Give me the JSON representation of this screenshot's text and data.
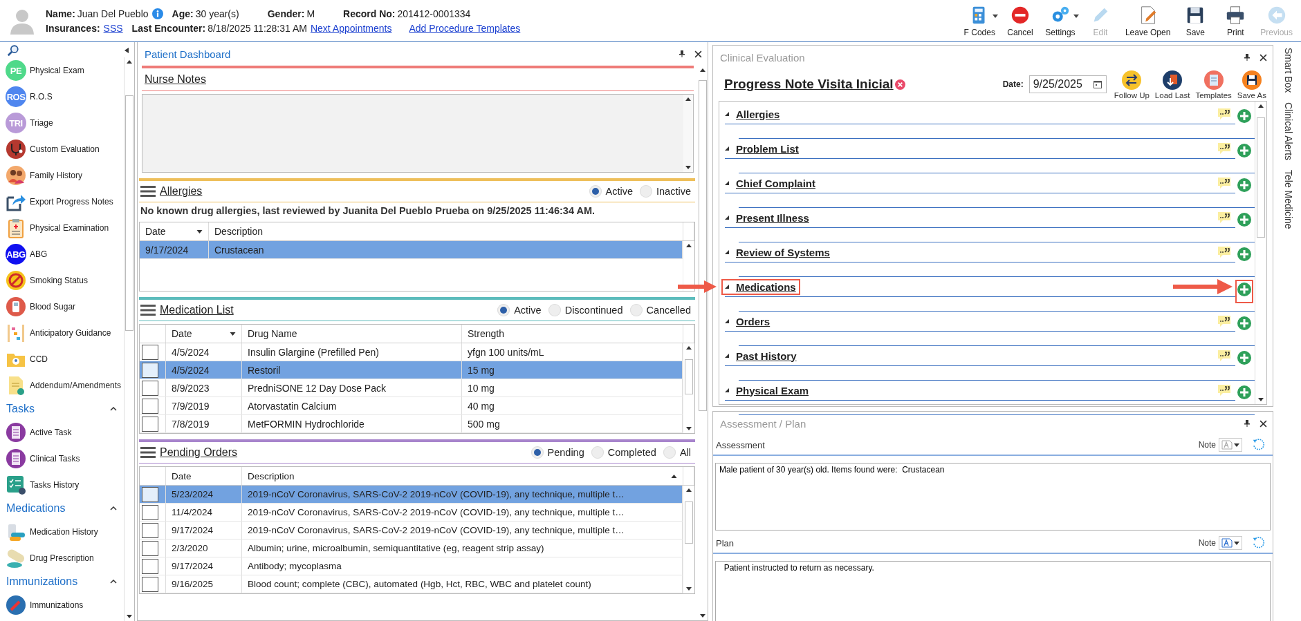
{
  "header": {
    "name_label": "Name:",
    "name": "Juan Del Pueblo",
    "age_label": "Age:",
    "age": "30 year(s)",
    "gender_label": "Gender:",
    "gender": "M",
    "record_label": "Record No:",
    "record": "201412-0001334",
    "insurances_label": "Insurances:",
    "insurance": "SSS",
    "last_encounter_label": "Last Encounter:",
    "last_encounter": "8/18/2025 11:28:31 AM",
    "links": [
      "Next Appointments",
      "Add Procedure Templates"
    ]
  },
  "toolbar": [
    {
      "label": "F Codes",
      "kind": "calculator",
      "dropdown": true,
      "disabled": false
    },
    {
      "label": "Cancel",
      "kind": "cancel",
      "dropdown": false,
      "disabled": false
    },
    {
      "label": "Settings",
      "kind": "gears",
      "dropdown": true,
      "disabled": false
    },
    {
      "label": "Edit",
      "kind": "pencil",
      "dropdown": false,
      "disabled": true
    },
    {
      "label": "Leave Open",
      "kind": "document",
      "dropdown": false,
      "disabled": false
    },
    {
      "label": "Save",
      "kind": "floppy",
      "dropdown": false,
      "disabled": false
    },
    {
      "label": "Print",
      "kind": "printer",
      "dropdown": false,
      "disabled": false
    },
    {
      "label": "Previous",
      "kind": "back",
      "dropdown": false,
      "disabled": true
    }
  ],
  "sidebar": {
    "groups": [
      {
        "items": [
          {
            "label": "Physical Exam",
            "kind": "badge",
            "badge": "PE",
            "color": "#4fd98a"
          },
          {
            "label": "R.O.S",
            "kind": "badge",
            "badge": "ROS",
            "color": "#4f86ef"
          },
          {
            "label": "Triage",
            "kind": "badge",
            "badge": "TRI",
            "color": "#b99ad8"
          },
          {
            "label": "Custom Evaluation",
            "kind": "stethoscope"
          },
          {
            "label": "Family History",
            "kind": "family"
          },
          {
            "label": "Export Progress Notes",
            "kind": "export"
          },
          {
            "label": "Physical Examination",
            "kind": "clipboard"
          },
          {
            "label": "ABG",
            "kind": "badge",
            "badge": "ABG",
            "color": "#1010f0"
          },
          {
            "label": "Smoking Status",
            "kind": "smoking"
          },
          {
            "label": "Blood Sugar",
            "kind": "glucometer"
          },
          {
            "label": "Anticipatory Guidance",
            "kind": "abacus"
          },
          {
            "label": "CCD",
            "kind": "folder"
          },
          {
            "label": "Addendum/Amendments",
            "kind": "note"
          }
        ]
      },
      {
        "title": "Tasks",
        "expanded": true,
        "items": [
          {
            "label": "Active Task",
            "kind": "task"
          },
          {
            "label": "Clinical Tasks",
            "kind": "task"
          },
          {
            "label": "Tasks History",
            "kind": "checklist"
          }
        ]
      },
      {
        "title": "Medications",
        "expanded": true,
        "items": [
          {
            "label": "Medication History",
            "kind": "pills"
          },
          {
            "label": "Drug Prescription",
            "kind": "capsule"
          }
        ]
      },
      {
        "title": "Immunizations",
        "expanded": true,
        "items": [
          {
            "label": "Immunizations",
            "kind": "syringe"
          }
        ]
      }
    ]
  },
  "dashboard": {
    "title": "Patient Dashboard",
    "nurse_notes": {
      "title": "Nurse Notes"
    },
    "allergies": {
      "title": "Allergies",
      "filters": [
        {
          "label": "Active",
          "selected": true
        },
        {
          "label": "Inactive",
          "selected": false
        }
      ],
      "summary": "No known drug allergies, last reviewed by Juanita Del Pueblo Prueba on 9/25/2025 11:46:34 AM.",
      "columns": [
        {
          "label": "Date"
        },
        {
          "label": "Description"
        }
      ],
      "rows": [
        {
          "date": "9/17/2024",
          "description": "Crustacean",
          "selected": true
        }
      ]
    },
    "medication_list": {
      "title": "Medication List",
      "filters": [
        {
          "label": "Active",
          "selected": true
        },
        {
          "label": "Discontinued",
          "selected": false
        },
        {
          "label": "Cancelled",
          "selected": false
        }
      ],
      "columns": [
        {
          "label": "Date"
        },
        {
          "label": "Drug Name"
        },
        {
          "label": "Strength"
        }
      ],
      "rows": [
        {
          "date": "4/5/2024",
          "drug": "Insulin Glargine (Prefilled Pen)",
          "strength": "yfgn 100 units/mL",
          "selected": false
        },
        {
          "date": "4/5/2024",
          "drug": "Restoril",
          "strength": "15 mg",
          "selected": true
        },
        {
          "date": "8/9/2023",
          "drug": "PredniSONE 12 Day Dose Pack",
          "strength": "10 mg",
          "selected": false
        },
        {
          "date": "7/9/2019",
          "drug": "Atorvastatin Calcium",
          "strength": "40 mg",
          "selected": false
        },
        {
          "date": "7/8/2019",
          "drug": "MetFORMIN Hydrochloride",
          "strength": "500 mg",
          "selected": false
        }
      ]
    },
    "pending_orders": {
      "title": "Pending Orders",
      "filters": [
        {
          "label": "Pending",
          "selected": true
        },
        {
          "label": "Completed",
          "selected": false
        },
        {
          "label": "All",
          "selected": false
        }
      ],
      "columns": [
        {
          "label": "Date"
        },
        {
          "label": "Description"
        }
      ],
      "rows": [
        {
          "date": "5/23/2024",
          "description": "2019-nCoV Coronavirus, SARS-CoV-2 2019-nCoV (COVID-19), any technique, multiple t…",
          "selected": true
        },
        {
          "date": "11/4/2024",
          "description": "2019-nCoV Coronavirus, SARS-CoV-2 2019-nCoV (COVID-19), any technique, multiple t…",
          "selected": false
        },
        {
          "date": "9/17/2024",
          "description": "2019-nCoV Coronavirus, SARS-CoV-2 2019-nCoV (COVID-19), any technique, multiple t…",
          "selected": false
        },
        {
          "date": "2/3/2020",
          "description": "Albumin; urine, microalbumin, semiquantitative (eg, reagent strip assay)",
          "selected": false
        },
        {
          "date": "9/17/2024",
          "description": "Antibody; mycoplasma",
          "selected": false
        },
        {
          "date": "9/16/2025",
          "description": "Blood count; complete (CBC), automated (Hgb, Hct, RBC, WBC and platelet count)",
          "selected": false
        }
      ]
    }
  },
  "clinical_evaluation": {
    "title": "Clinical Evaluation",
    "note_title": "Progress Note Visita Inicial",
    "date_label": "Date:",
    "date": "9/25/2025",
    "actions": [
      {
        "label": "Follow Up",
        "kind": "swap"
      },
      {
        "label": "Load Last",
        "kind": "load"
      },
      {
        "label": "Templates",
        "kind": "templates"
      },
      {
        "label": "Save As",
        "kind": "saveas"
      }
    ],
    "sections": [
      {
        "title": "Allergies",
        "highlighted": false
      },
      {
        "title": "Problem List",
        "highlighted": false
      },
      {
        "title": "Chief Complaint",
        "highlighted": false
      },
      {
        "title": "Present Illness",
        "highlighted": false
      },
      {
        "title": "Review of Systems",
        "highlighted": false
      },
      {
        "title": "Medications",
        "highlighted": true
      },
      {
        "title": "Orders",
        "highlighted": false
      },
      {
        "title": "Past History",
        "highlighted": false
      },
      {
        "title": "Physical Exam",
        "highlighted": false
      }
    ]
  },
  "assessment_plan": {
    "title": "Assessment / Plan",
    "fields": [
      {
        "label": "Assessment",
        "note_label": "Note",
        "note_active": false,
        "text": "Male patient of 30 year(s) old. Items found were:  Crustacean"
      },
      {
        "label": "Plan",
        "note_label": "Note",
        "note_active": true,
        "text": "  Patient instructed to return as necessary."
      }
    ]
  },
  "side_tabs": [
    "Smart Box",
    "Clinical Alerts",
    "Tele Medicine"
  ]
}
